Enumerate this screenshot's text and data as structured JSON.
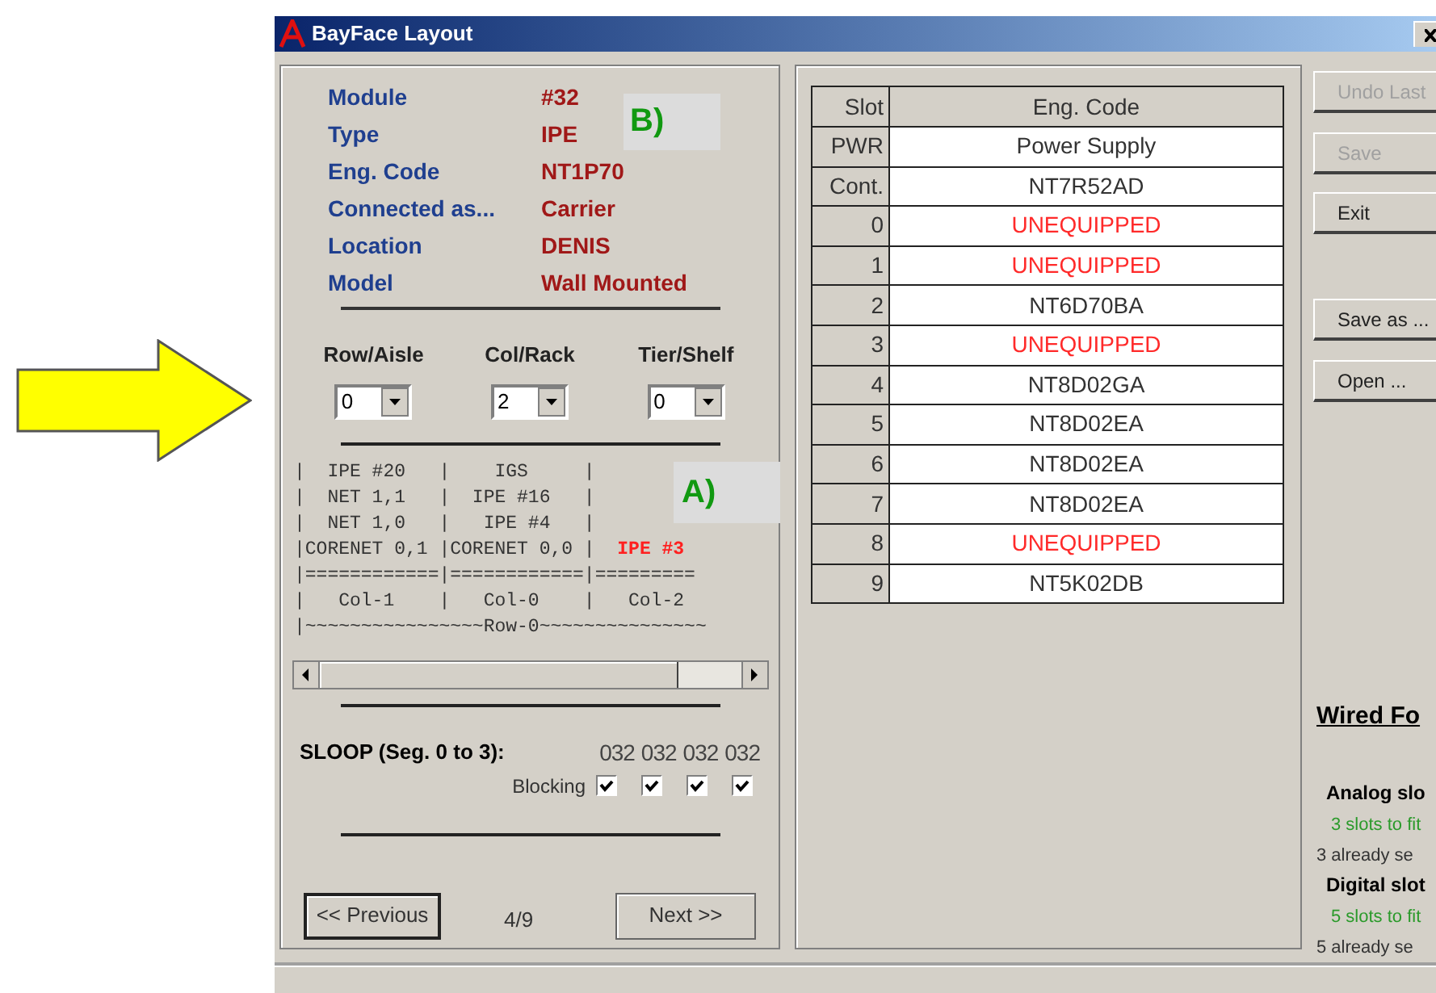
{
  "window": {
    "title": "BayFace Layout"
  },
  "annotations": [
    {
      "label": "B)"
    },
    {
      "label": "A)"
    }
  ],
  "module_info": [
    {
      "label": "Module",
      "value": "#32"
    },
    {
      "label": "Type",
      "value": "IPE"
    },
    {
      "label": "Eng. Code",
      "value": "NT1P70"
    },
    {
      "label": "Connected as...",
      "value": "Carrier"
    },
    {
      "label": "Location",
      "value": "DENIS"
    },
    {
      "label": "Model",
      "value": "Wall Mounted"
    }
  ],
  "position": [
    {
      "label": "Row/Aisle",
      "value": "0"
    },
    {
      "label": "Col/Rack",
      "value": "2"
    },
    {
      "label": "Tier/Shelf",
      "value": "0"
    }
  ],
  "diagram_lines": [
    {
      "segments": [
        {
          "text": "|  IPE #20   |    IGS     |",
          "highlighted": false
        }
      ]
    },
    {
      "segments": [
        {
          "text": "|  NET 1,1   |  IPE #16   |",
          "highlighted": false
        }
      ]
    },
    {
      "segments": [
        {
          "text": "|  NET 1,0   |   IPE #4   |",
          "highlighted": false
        }
      ]
    },
    {
      "segments": [
        {
          "text": "|CORENET 0,1 |CORENET 0,0 |",
          "highlighted": false
        },
        {
          "text": "  IPE #3",
          "highlighted": true
        }
      ]
    },
    {
      "segments": [
        {
          "text": "|============|============|=========",
          "highlighted": false
        }
      ]
    },
    {
      "segments": [
        {
          "text": "|   Col-1    |   Col-0    |   Col-2",
          "highlighted": false
        }
      ]
    },
    {
      "segments": [
        {
          "text": "|~~~~~~~~~~~~~~~~Row-0~~~~~~~~~~~~~~~",
          "highlighted": false
        }
      ]
    }
  ],
  "sloop": {
    "label": "SLOOP (Seg. 0 to 3):",
    "blocking_label": "Blocking",
    "segments": [
      {
        "value": "032",
        "checked": true
      },
      {
        "value": "032",
        "checked": true
      },
      {
        "value": "032",
        "checked": true
      },
      {
        "value": "032",
        "checked": true
      }
    ]
  },
  "navigation": {
    "previous": "<< Previous",
    "page": "4/9",
    "next": "Next >>"
  },
  "slot_table": {
    "columns": [
      "Slot",
      "Eng. Code"
    ],
    "rows": [
      {
        "slot": "PWR",
        "code": "Power Supply",
        "unequipped": false
      },
      {
        "slot": "Cont.",
        "code": "NT7R52AD",
        "unequipped": false
      },
      {
        "slot": "0",
        "code": "UNEQUIPPED",
        "unequipped": true
      },
      {
        "slot": "1",
        "code": "UNEQUIPPED",
        "unequipped": true
      },
      {
        "slot": "2",
        "code": "NT6D70BA",
        "unequipped": false
      },
      {
        "slot": "3",
        "code": "UNEQUIPPED",
        "unequipped": true
      },
      {
        "slot": "4",
        "code": "NT8D02GA",
        "unequipped": false
      },
      {
        "slot": "5",
        "code": "NT8D02EA",
        "unequipped": false
      },
      {
        "slot": "6",
        "code": "NT8D02EA",
        "unequipped": false
      },
      {
        "slot": "7",
        "code": "NT8D02EA",
        "unequipped": false
      },
      {
        "slot": "8",
        "code": "UNEQUIPPED",
        "unequipped": true
      },
      {
        "slot": "9",
        "code": "NT5K02DB",
        "unequipped": false
      }
    ]
  },
  "buttons": [
    {
      "label": "Undo Last",
      "disabled": true
    },
    {
      "label": "Save",
      "disabled": true
    },
    {
      "label": "Exit",
      "disabled": false
    },
    {
      "label": "Save as ...",
      "disabled": false
    },
    {
      "label": "Open ...",
      "disabled": false
    }
  ],
  "wired": {
    "title": "Wired Fo",
    "groups": [
      {
        "heading": "Analog slo",
        "fit": "3 slots to fit",
        "set": "3 already se"
      },
      {
        "heading": "Digital slot",
        "fit": "5 slots to fit",
        "set": "5 already se"
      }
    ]
  }
}
